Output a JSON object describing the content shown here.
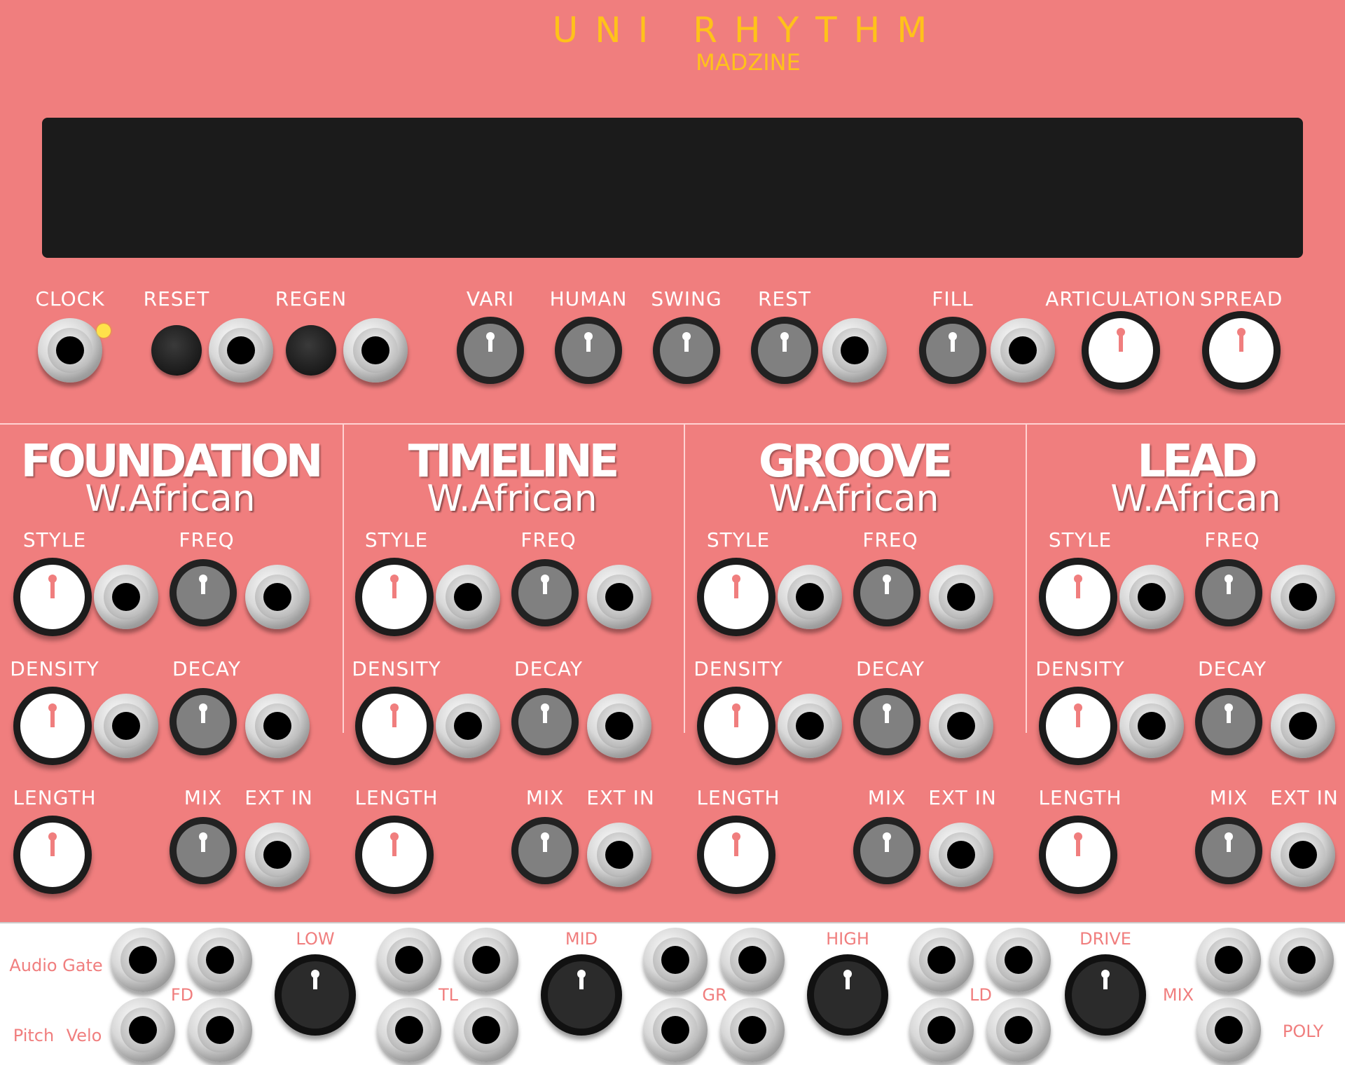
{
  "header": {
    "title": "UNI RHYTHM",
    "brand": "MADZINE"
  },
  "colors": {
    "panel": "#f07e7e",
    "accent": "#ffc21a",
    "knob_pointer_white": "#ffffff",
    "knob_pointer_red": "#f07e7e"
  },
  "top_controls": {
    "clock": "CLOCK",
    "reset": "RESET",
    "regen": "REGEN",
    "vari": "VARI",
    "human": "HUMAN",
    "swing": "SWING",
    "rest": "REST",
    "fill": "FILL",
    "articulation": "ARTICULATION",
    "spread": "SPREAD"
  },
  "sections": [
    {
      "name": "FOUNDATION",
      "style": "W.African"
    },
    {
      "name": "TIMELINE",
      "style": "W.African"
    },
    {
      "name": "GROOVE",
      "style": "W.African"
    },
    {
      "name": "LEAD",
      "style": "W.African"
    }
  ],
  "section_labels": {
    "style": "STYLE",
    "freq": "FREQ",
    "density": "DENSITY",
    "decay": "DECAY",
    "length": "LENGTH",
    "mix": "MIX",
    "ext_in": "EXT IN"
  },
  "bottom": {
    "audio_gate": "Audio Gate",
    "pitch": "Pitch",
    "velo": "Velo",
    "fd": "FD",
    "tl": "TL",
    "gr": "GR",
    "ld": "LD",
    "low": "LOW",
    "mid": "MID",
    "high": "HIGH",
    "drive": "DRIVE",
    "mix": "MIX",
    "poly": "POLY"
  }
}
